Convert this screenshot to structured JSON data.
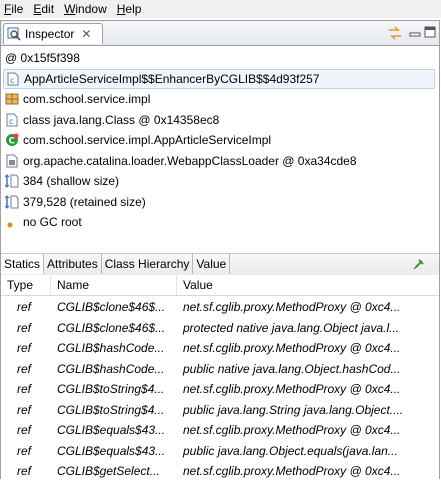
{
  "menubar": {
    "items": [
      {
        "label": "File",
        "underline": "F"
      },
      {
        "label": "Edit",
        "underline": "E"
      },
      {
        "label": "Window",
        "underline": "W"
      },
      {
        "label": "Help",
        "underline": "H"
      }
    ]
  },
  "view": {
    "tab_label": "Inspector",
    "tab_close": "✕",
    "toolbar_icons": [
      "link-with-selection-icon",
      "minimize-icon",
      "maximize-icon"
    ]
  },
  "info_rows": [
    {
      "icon": "at-icon",
      "text": "@ 0x15f5f398"
    },
    {
      "icon": "class-file-icon",
      "text": "AppArticleServiceImpl$$EnhancerByCGLIB$$4d93f257",
      "selected": true
    },
    {
      "icon": "package-icon",
      "text": "com.school.service.impl"
    },
    {
      "icon": "class-file-icon",
      "text": "class java.lang.Class @ 0x14358ec8"
    },
    {
      "icon": "superclass-icon",
      "text": "com.school.service.impl.AppArticleServiceImpl"
    },
    {
      "icon": "classloader-icon",
      "text": "org.apache.catalina.loader.WebappClassLoader @ 0xa34cde8"
    },
    {
      "icon": "size-icon",
      "text": "384 (shallow size)"
    },
    {
      "icon": "size-icon",
      "text": "379,528 (retained size)"
    },
    {
      "icon": "gc-root-icon",
      "text": "no GC root"
    }
  ],
  "subtabs": [
    {
      "label": "Statics",
      "active": true
    },
    {
      "label": "Attributes"
    },
    {
      "label": "Class Hierarchy"
    },
    {
      "label": "Value"
    }
  ],
  "grid": {
    "columns": [
      "Type",
      "Name",
      "Value"
    ],
    "rows": [
      {
        "type": "ref",
        "name": "CGLIB$clone$46$...",
        "value": "net.sf.cglib.proxy.MethodProxy @ 0xc4..."
      },
      {
        "type": "ref",
        "name": "CGLIB$clone$46$...",
        "value": "protected native java.lang.Object java.l..."
      },
      {
        "type": "ref",
        "name": "CGLIB$hashCode...",
        "value": "net.sf.cglib.proxy.MethodProxy @ 0xc4..."
      },
      {
        "type": "ref",
        "name": "CGLIB$hashCode...",
        "value": "public native  java.lang.Object.hashCod..."
      },
      {
        "type": "ref",
        "name": "CGLIB$toString$4...",
        "value": "net.sf.cglib.proxy.MethodProxy @ 0xc4..."
      },
      {
        "type": "ref",
        "name": "CGLIB$toString$4...",
        "value": "public java.lang.String java.lang.Object...."
      },
      {
        "type": "ref",
        "name": "CGLIB$equals$43...",
        "value": "net.sf.cglib.proxy.MethodProxy @ 0xc4..."
      },
      {
        "type": "ref",
        "name": "CGLIB$equals$43...",
        "value": "public  java.lang.Object.equals(java.lan..."
      },
      {
        "type": "ref",
        "name": "CGLIB$getSelect...",
        "value": "net.sf.cglib.proxy.MethodProxy @ 0xc4..."
      }
    ]
  },
  "colors": {
    "selection_bg": "#f0f4fb",
    "icon_blue": "#3a6fc4",
    "icon_green": "#2e9a3e",
    "icon_orange": "#e08a1e"
  }
}
